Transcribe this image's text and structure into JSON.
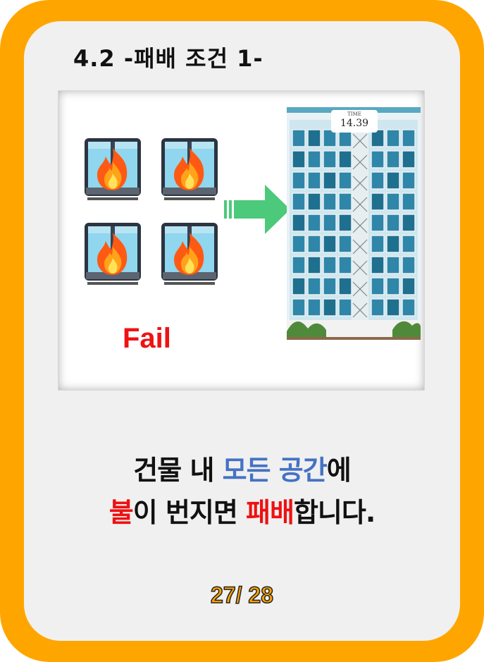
{
  "title": "4.2 -패배 조건 1-",
  "illustration": {
    "fail_label": "Fail",
    "timer": {
      "label": "TIME",
      "value": "14.39"
    },
    "burning_window_icons": [
      "fire-window-icon",
      "fire-window-icon",
      "fire-window-icon",
      "fire-window-icon"
    ],
    "arrow_color": "#4cc97a"
  },
  "message": {
    "line1": [
      {
        "text": "건물 내 ",
        "style": "normal"
      },
      {
        "text": "모든 공간",
        "style": "blue"
      },
      {
        "text": "에",
        "style": "normal"
      }
    ],
    "line2": [
      {
        "text": "불",
        "style": "red"
      },
      {
        "text": "이 번지면 ",
        "style": "normal"
      },
      {
        "text": "패배",
        "style": "red"
      },
      {
        "text": "합니다.",
        "style": "normal"
      }
    ]
  },
  "page_indicator": "27/ 28",
  "colors": {
    "frame": "#ffa500",
    "blue": "#4472c4",
    "red": "#ee1111",
    "fail": "#ef1212"
  }
}
